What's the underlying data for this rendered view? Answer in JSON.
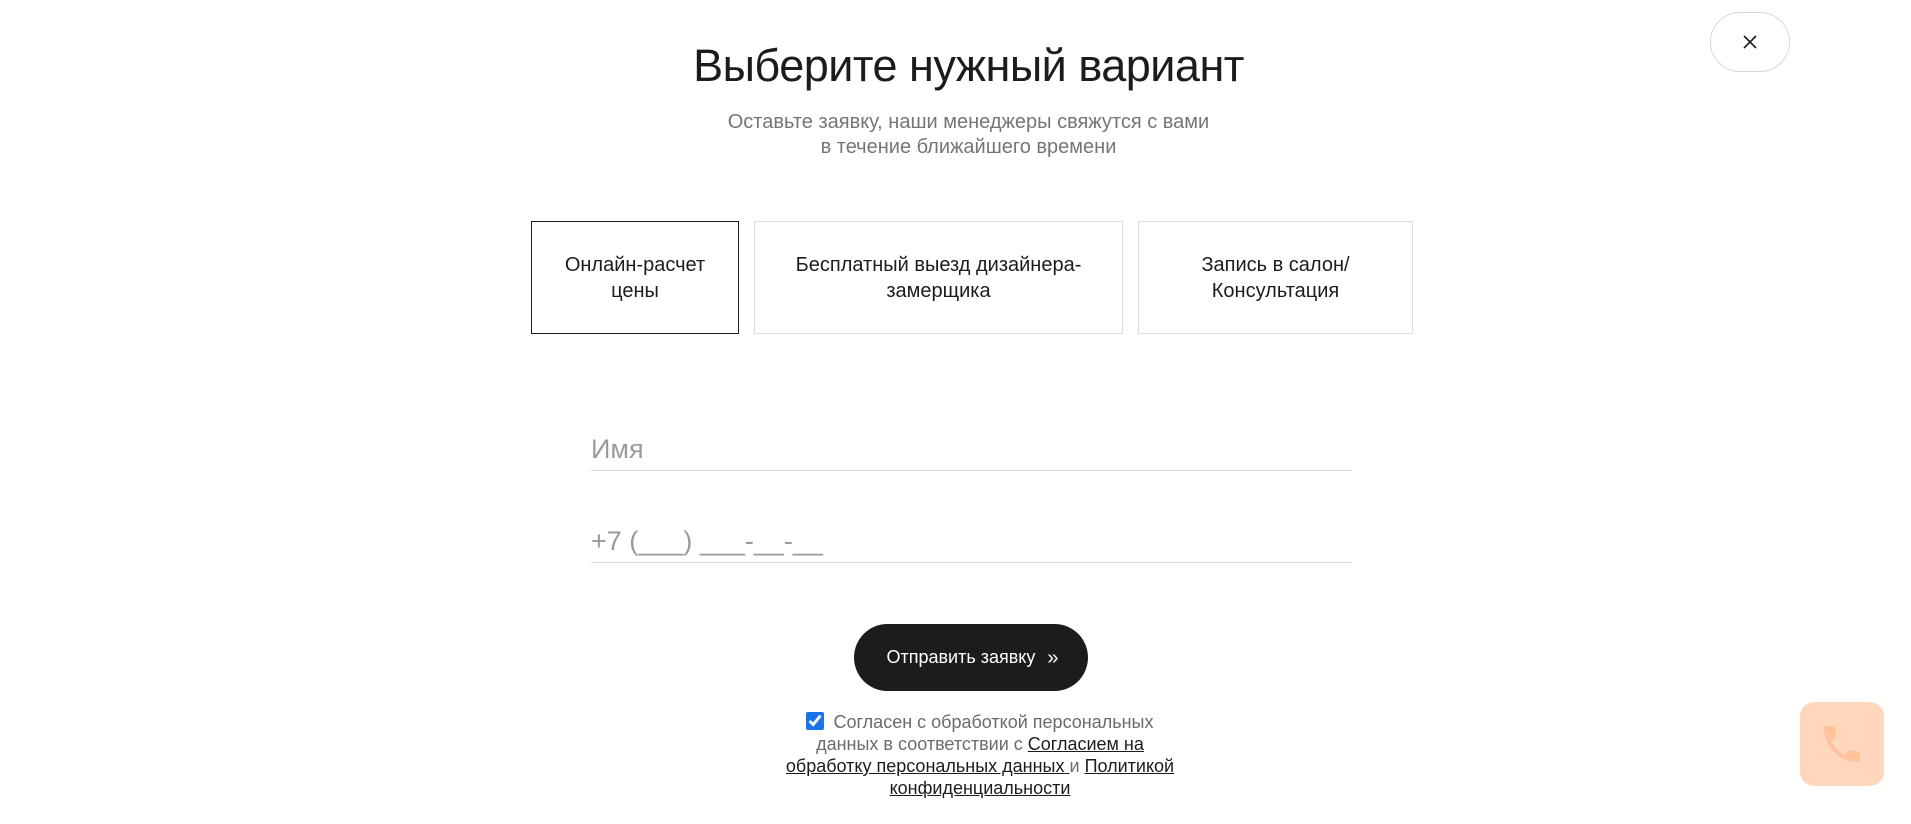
{
  "modal": {
    "title": "Выберите нужный вариант",
    "subtitle_line1": "Оставьте заявку, наши менеджеры свяжутся с вами",
    "subtitle_line2": "в течение ближайшего времени"
  },
  "tabs": [
    {
      "line1": "Онлайн-расчет",
      "line2": "цены",
      "active": true
    },
    {
      "line1": "Бесплатный выезд дизайнера-",
      "line2": "замерщика",
      "active": false
    },
    {
      "line1": "Запись в салон/",
      "line2": "Консультация",
      "active": false
    }
  ],
  "form": {
    "name_placeholder": "Имя",
    "name_value": "",
    "phone_placeholder": "+7 (___) ___-__-__",
    "phone_value": "",
    "submit_label": "Отправить заявку",
    "submit_arrows": "»"
  },
  "consent": {
    "checked": true,
    "text_before": "Согласен с обработкой персональных данных в соответствии с ",
    "link1": "Согласием на обработку персональных данных ",
    "text_between": "и ",
    "link2": "Политикой конфиденциальности"
  },
  "icons": {
    "close": "close-icon",
    "phone": "phone-icon"
  },
  "colors": {
    "primary_button": "#1c1c1c",
    "call_widget": "#ffd7bd",
    "call_icon": "#ffc29a",
    "checkbox": "#1a73e8"
  }
}
